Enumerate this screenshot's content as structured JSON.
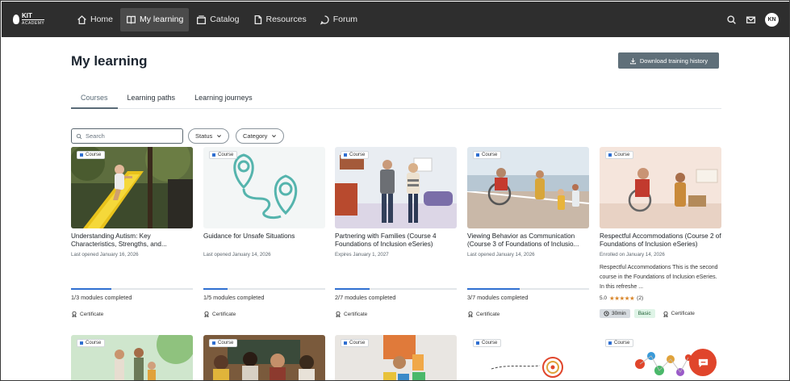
{
  "nav": {
    "logo_text": "KIT",
    "logo_sub": "ACADEMY",
    "items": [
      {
        "label": "Home",
        "icon": "home-icon"
      },
      {
        "label": "My learning",
        "icon": "book-icon",
        "active": true
      },
      {
        "label": "Catalog",
        "icon": "catalog-icon"
      },
      {
        "label": "Resources",
        "icon": "document-icon"
      },
      {
        "label": "Forum",
        "icon": "chat-bubble-icon"
      }
    ],
    "avatar_initials": "KN"
  },
  "page": {
    "title": "My learning",
    "download_label": "Download training history"
  },
  "tabs": [
    "Courses",
    "Learning paths",
    "Learning journeys"
  ],
  "filters": {
    "search_placeholder": "Search",
    "status_label": "Status",
    "category_label": "Category"
  },
  "badge_label": "Course",
  "certificate_label": "Certificate",
  "courses": [
    {
      "title": "Understanding Autism: Key Characteristics, Strengths, and...",
      "meta": "Last opened January 16, 2026",
      "modules": "1/3 modules completed",
      "progress": 0.333
    },
    {
      "title": "Guidance for Unsafe Situations",
      "meta": "Last opened January 14, 2026",
      "modules": "1/5 modules completed",
      "progress": 0.2
    },
    {
      "title": "Partnering with Families (Course 4 Foundations of Inclusion eSeries)",
      "meta": "Expires January 1, 2027",
      "modules": "2/7 modules completed",
      "progress": 0.286
    },
    {
      "title": "Viewing Behavior as Communication (Course 3 of Foundations of Inclusio...",
      "meta": "Last opened January 14, 2026",
      "modules": "3/7 modules completed",
      "progress": 0.429
    },
    {
      "title": "Respectful Accommodations (Course 2 of Foundations of Inclusion eSeries)",
      "meta": "Enrolled on January 14, 2026",
      "description": "Respectful Accommodations This is the second course in the Foundations of Inclusion eSeries. In this refreshe ...",
      "rating_value": "5.0",
      "rating_stars": "★★★★★",
      "rating_count": "(2)",
      "stars": 5,
      "duration": "30min",
      "level": "Basic"
    }
  ]
}
